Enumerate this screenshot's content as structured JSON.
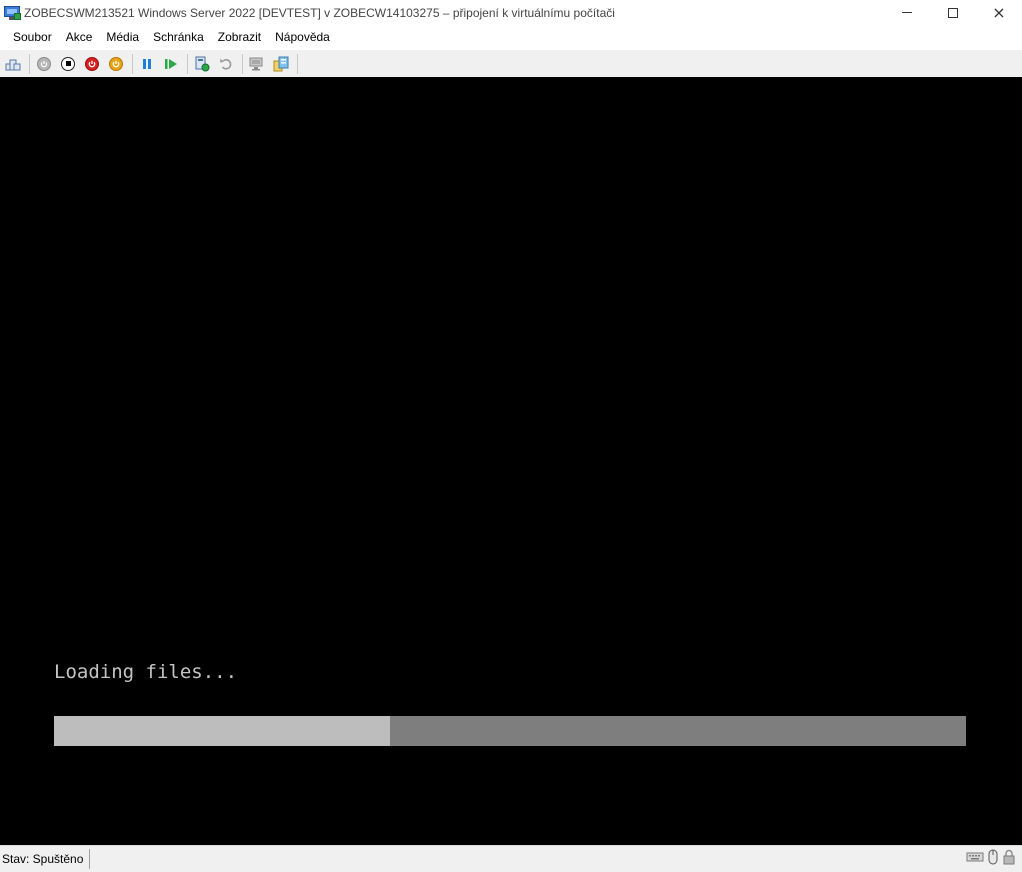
{
  "window": {
    "title": "ZOBECSWM213521 Windows Server 2022 [DEVTEST] v ZOBECW14103275 – připojení k virtuálnímu počítači",
    "controls": {
      "minimize": "minimize-icon",
      "maximize": "maximize-icon",
      "close": "×"
    }
  },
  "menu": {
    "items": [
      {
        "label": "Soubor"
      },
      {
        "label": "Akce"
      },
      {
        "label": "Média"
      },
      {
        "label": "Schránka"
      },
      {
        "label": "Zobrazit"
      },
      {
        "label": "Nápověda"
      }
    ]
  },
  "toolbar": {
    "icons": [
      "ctrl-alt-del-icon",
      "start-icon",
      "turn-off-icon",
      "shutdown-icon",
      "power-icon",
      "pause-icon",
      "resume-icon",
      "checkpoint-icon",
      "revert-icon",
      "enhanced-session-icon",
      "share-icon"
    ]
  },
  "vm_screen": {
    "message": "Loading files...",
    "progress": 0.368
  },
  "status": {
    "label": "Stav: Spuštěno"
  },
  "colors": {
    "screen_bg": "#000000",
    "progress_fill": "#bdbdbd",
    "progress_track": "#7e7e7e",
    "text": "#c4c4c4",
    "red_button": "#d62020",
    "orange_button": "#e8a318",
    "blue_pause": "#1e7fd6",
    "green_play": "#2aa84a"
  }
}
